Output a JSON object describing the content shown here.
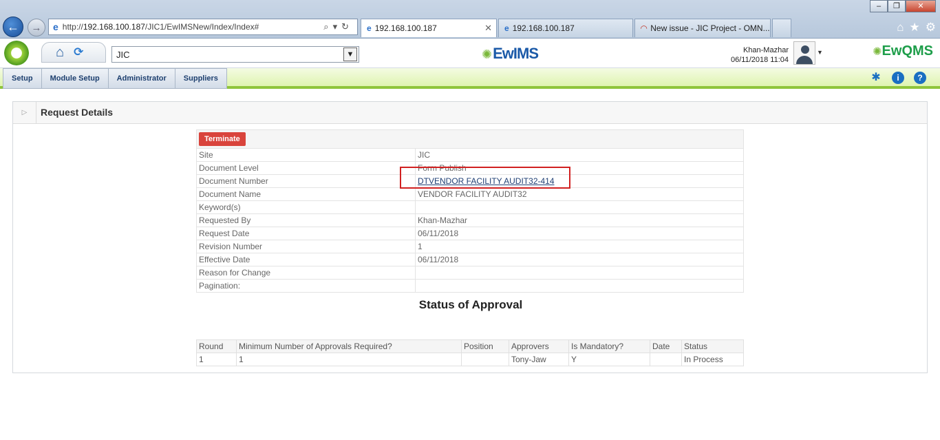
{
  "browser": {
    "url_prefix": "http://",
    "url_host": "192.168.100.187",
    "url_path": "/JIC1/EwIMSNew/Index/Index#",
    "tabs": [
      {
        "title": "192.168.100.187"
      },
      {
        "title": "192.168.100.187"
      },
      {
        "title": "New issue - JIC Project - OMN..."
      }
    ]
  },
  "header": {
    "site_value": "JIC",
    "logo_text": "EwIMS",
    "user_name": "Khan-Mazhar",
    "datetime": "06/11/2018 11:04",
    "brand_right": "EwQMS"
  },
  "menu": {
    "items": [
      "Setup",
      "Module Setup",
      "Administrator",
      "Suppliers"
    ]
  },
  "panel": {
    "title": "Request Details",
    "terminate_label": "Terminate",
    "fields": [
      {
        "label": "Site",
        "value": "JIC"
      },
      {
        "label": "Document Level",
        "value": "Form Publish"
      },
      {
        "label": "Document Number",
        "value": "DTVENDOR FACILITY AUDIT32-414"
      },
      {
        "label": "Document Name",
        "value": "VENDOR FACILITY AUDIT32"
      },
      {
        "label": "Keyword(s)",
        "value": ""
      },
      {
        "label": "Requested By",
        "value": "Khan-Mazhar"
      },
      {
        "label": "Request Date",
        "value": "06/11/2018"
      },
      {
        "label": "Revision Number",
        "value": "1"
      },
      {
        "label": "Effective Date",
        "value": "06/11/2018"
      },
      {
        "label": "Reason for Change",
        "value": ""
      },
      {
        "label": "Pagination:",
        "value": ""
      }
    ],
    "status_title": "Status of Approval",
    "approval_headers": [
      "Round",
      "Minimum Number of Approvals Required?",
      "Position",
      "Approvers",
      "Is Mandatory?",
      "Date",
      "Status"
    ],
    "approval_rows": [
      [
        "1",
        "1",
        "",
        "Tony-Jaw",
        "Y",
        "",
        "In Process"
      ]
    ]
  },
  "colors": {
    "menu_accent": "#8fc53b",
    "terminate": "#d9443c",
    "highlight": "#d12020"
  }
}
